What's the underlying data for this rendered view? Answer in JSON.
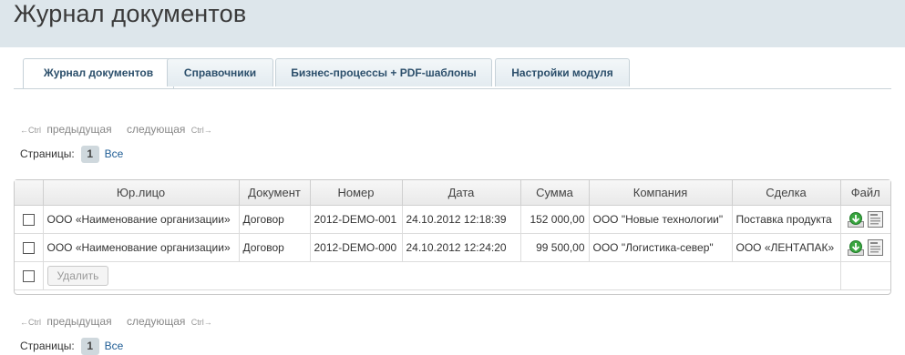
{
  "page": {
    "title": "Журнал документов"
  },
  "tabs": [
    {
      "label": "Журнал документов",
      "active": true
    },
    {
      "label": "Справочники",
      "active": false
    },
    {
      "label": "Бизнес-процессы + PDF-шаблоны",
      "active": false
    },
    {
      "label": "Настройки модуля",
      "active": false
    }
  ],
  "nav": {
    "ctrl_left": "←Ctrl",
    "prev": "предыдущая",
    "next": "следующая",
    "ctrl_right": "Ctrl→"
  },
  "pages": {
    "label": "Страницы:",
    "current": "1",
    "all": "Все"
  },
  "table": {
    "columns": [
      "Юр.лицо",
      "Документ",
      "Номер",
      "Дата",
      "Сумма",
      "Компания",
      "Сделка",
      "Файл"
    ],
    "rows": [
      {
        "entity": "ООО «Наименование организации»",
        "document": "Договор",
        "number": "2012-DEMO-001",
        "date": "24.10.2012 12:18:39",
        "sum": "152 000,00",
        "company": "ООО \"Новые технологии\"",
        "deal": "Поставка продукта"
      },
      {
        "entity": "ООО «Наименование организации»",
        "document": "Договор",
        "number": "2012-DEMO-000",
        "date": "24.10.2012 12:24:20",
        "sum": "99 500,00",
        "company": "ООО \"Логистика-север\"",
        "deal": "ООО «ЛЕНТАПАК»"
      }
    ],
    "delete_label": "Удалить"
  },
  "colors": {
    "link": "#1e5c94",
    "header_bg": "#dde6eb",
    "accent_green": "#2f9a3a"
  },
  "icons": [
    "download-icon",
    "document-icon",
    "checkbox-icon",
    "arrow-left-icon",
    "arrow-right-icon"
  ]
}
